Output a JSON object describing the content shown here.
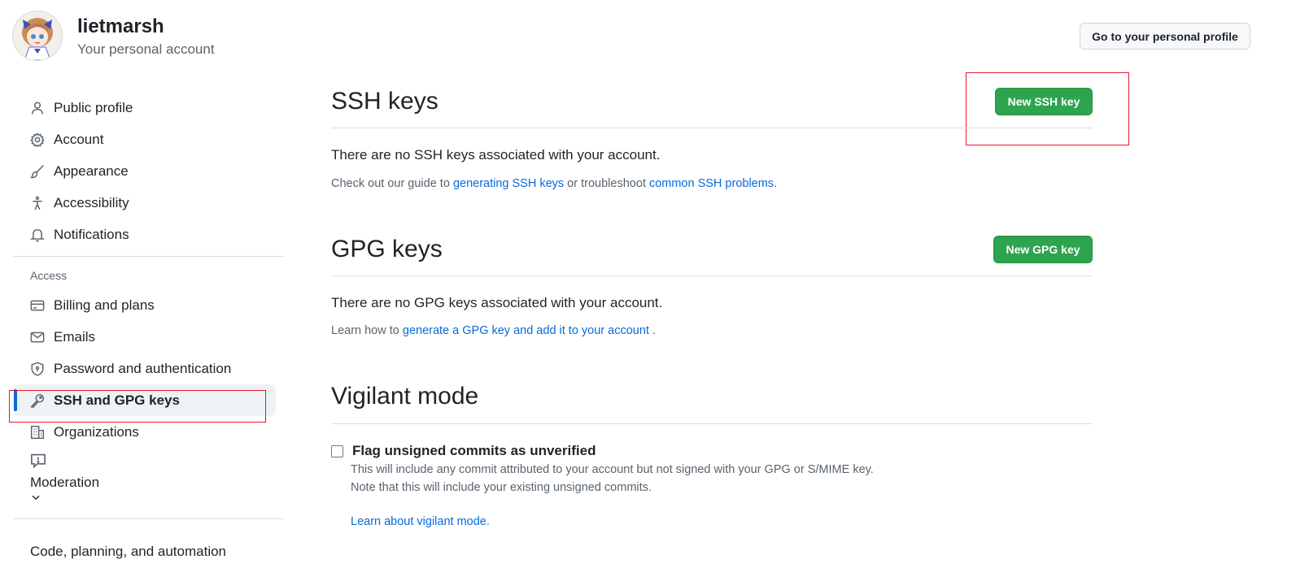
{
  "header": {
    "username": "lietmarsh",
    "subtitle": "Your personal account",
    "profile_button": "Go to your personal profile"
  },
  "sidebar": {
    "items": [
      {
        "label": "Public profile",
        "icon": "person-icon"
      },
      {
        "label": "Account",
        "icon": "gear-icon"
      },
      {
        "label": "Appearance",
        "icon": "paintbrush-icon"
      },
      {
        "label": "Accessibility",
        "icon": "accessibility-icon"
      },
      {
        "label": "Notifications",
        "icon": "bell-icon"
      }
    ],
    "access_heading": "Access",
    "access_items": [
      {
        "label": "Billing and plans",
        "icon": "credit-card-icon"
      },
      {
        "label": "Emails",
        "icon": "mail-icon"
      },
      {
        "label": "Password and authentication",
        "icon": "shield-lock-icon"
      },
      {
        "label": "SSH and GPG keys",
        "icon": "key-icon",
        "active": true
      },
      {
        "label": "Organizations",
        "icon": "organization-icon"
      }
    ],
    "moderation_label": "Moderation",
    "cut_off_label": "Code, planning, and automation"
  },
  "ssh": {
    "title": "SSH keys",
    "new_button": "New SSH key",
    "empty_text": "There are no SSH keys associated with your account.",
    "guide_prefix": "Check out our guide to ",
    "guide_link1": "generating SSH keys",
    "guide_middle": " or troubleshoot ",
    "guide_link2": "common SSH problems",
    "guide_suffix": "."
  },
  "gpg": {
    "title": "GPG keys",
    "new_button": "New GPG key",
    "empty_text": "There are no GPG keys associated with your account.",
    "learn_prefix": "Learn how to ",
    "learn_link": "generate a GPG key and add it to your account",
    "learn_suffix": " ."
  },
  "vigilant": {
    "title": "Vigilant mode",
    "checkbox_label": "Flag unsigned commits as unverified",
    "desc_line1": "This will include any commit attributed to your account but not signed with your GPG or S/MIME key.",
    "desc_line2": "Note that this will include your existing unsigned commits.",
    "learn_link": "Learn about vigilant mode."
  },
  "colors": {
    "accent_blue": "#0969da",
    "button_green": "#2da44e",
    "highlight_red": "#e5172c"
  }
}
